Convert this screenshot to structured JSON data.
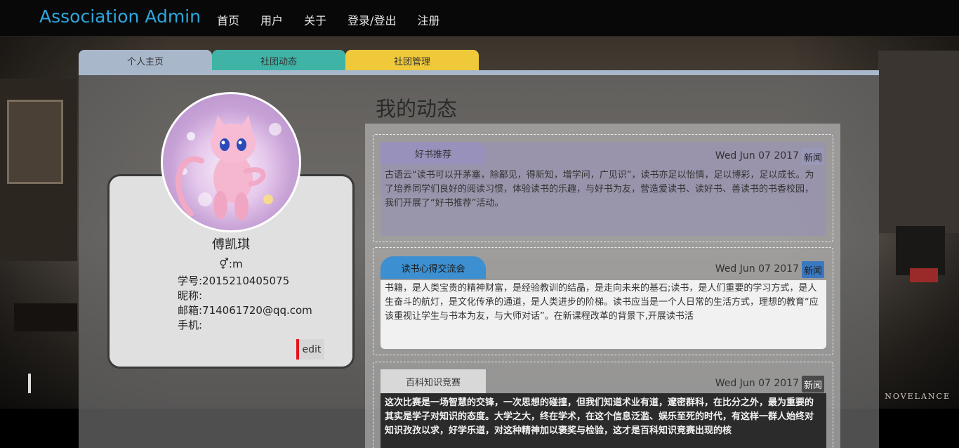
{
  "navbar": {
    "brand": "Association Admin",
    "links": [
      "首页",
      "用户",
      "关于",
      "登录/登出",
      "注册"
    ]
  },
  "tabs": [
    "个人主页",
    "社团动态",
    "社团管理"
  ],
  "profile": {
    "name": "傅凯琪",
    "gender": "⚥:m",
    "student_id": "学号:2015210405075",
    "nickname": "昵称:",
    "email": "邮箱:714061720@qq.com",
    "phone": "手机:",
    "edit_label": "edit",
    "avatar_icon": "pink-cat-avatar"
  },
  "feed": {
    "title": "我的动态",
    "posts": [
      {
        "label": "好书推荐",
        "date": "Wed Jun 07 2017",
        "tag": "新闻",
        "text": "古语云“读书可以开茅塞，除鄙见，得新知，增学问，广见识”，读书亦足以怡情，足以博彩，足以成长。为了培养同学们良好的阅读习惯，体验读书的乐趣，与好书为友，营造爱读书、读好书、善读书的书香校园，我们开展了“好书推荐”活动。"
      },
      {
        "label": "读书心得交流会",
        "date": "Wed Jun 07 2017",
        "tag": "新闻",
        "text": "书籍，是人类宝贵的精神财富，是经验教训的结晶，是走向未来的基石;读书，是人们重要的学习方式，是人生奋斗的航灯，是文化传承的通道，是人类进步的阶梯。读书应当是一个人日常的生活方式，理想的教育“应该重视让学生与书本为友，与大师对话”。在新课程改革的背景下,开展读书活"
      },
      {
        "label": "百科知识竞赛",
        "date": "Wed Jun 07 2017",
        "tag": "新闻",
        "text": "这次比赛是一场智慧的交锋，一次思想的碰撞，但我们知道术业有道，邃密群科，在比分之外，最为重要的其实是学子对知识的态度。大学之大，终在学术，在这个信息泛滥、娱乐至死的时代，有这样一群人始终对知识孜孜以求，好学乐道，对这种精神加以褒奖与检验，这才是百科知识竞赛出现的核"
      }
    ]
  },
  "background": {
    "watermark": "NOVELANCE"
  },
  "colors": {
    "brand": "#2ea6dd",
    "tab1": "#a9b7cb",
    "tab2": "#3fb3a5",
    "tab3": "#f0c93a",
    "edit_accent": "#e0141e"
  }
}
